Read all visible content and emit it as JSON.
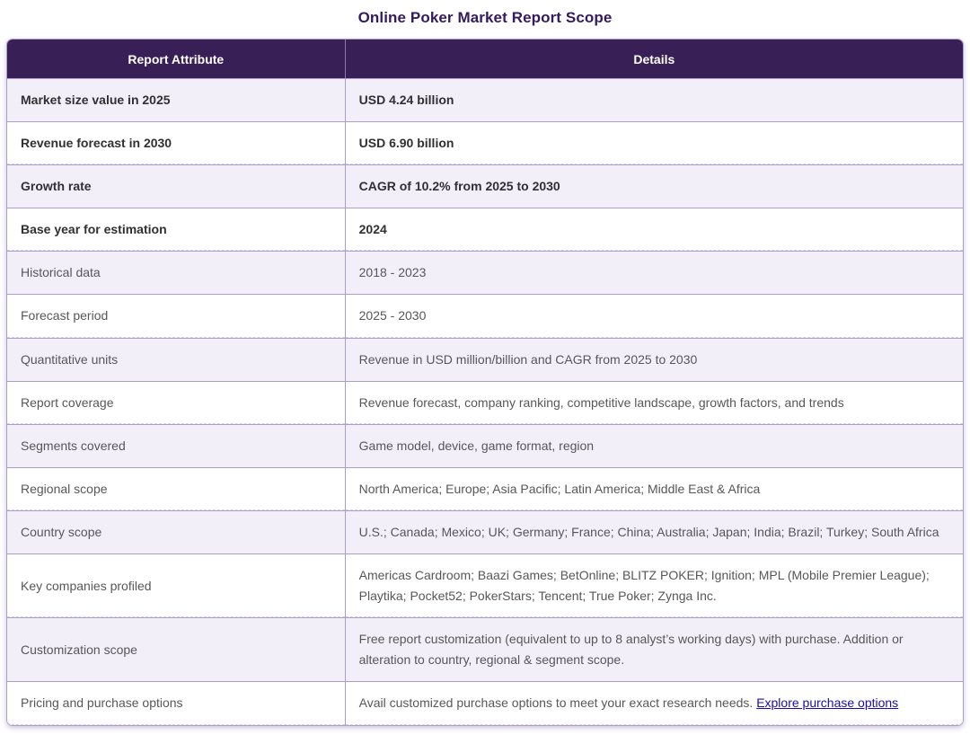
{
  "page": {
    "title": "Online Poker Market Report Scope"
  },
  "table": {
    "headers": {
      "attribute": "Report Attribute",
      "details": "Details"
    },
    "rows": [
      {
        "attribute": "Market size value in 2025",
        "details": "USD 4.24 billion"
      },
      {
        "attribute": "Revenue forecast in 2030",
        "details": "USD 6.90 billion"
      },
      {
        "attribute": "Growth rate",
        "details": "CAGR of 10.2% from 2025 to 2030"
      },
      {
        "attribute": "Base year for estimation",
        "details": "2024"
      },
      {
        "attribute": "Historical data",
        "details": "2018 - 2023"
      },
      {
        "attribute": "Forecast period",
        "details": "2025 - 2030"
      },
      {
        "attribute": "Quantitative units",
        "details": "Revenue in USD million/billion and CAGR from 2025 to 2030"
      },
      {
        "attribute": "Report coverage",
        "details": "Revenue forecast, company ranking, competitive landscape, growth factors, and trends"
      },
      {
        "attribute": "Segments covered",
        "details": "Game model, device, game format, region"
      },
      {
        "attribute": "Regional scope",
        "details": "North America; Europe; Asia Pacific; Latin America; Middle East & Africa"
      },
      {
        "attribute": "Country scope",
        "details": "U.S.; Canada; Mexico; UK; Germany; France; China; Australia; Japan; India; Brazil; Turkey; South Africa"
      },
      {
        "attribute": "Key companies profiled",
        "details": "Americas Cardroom; Baazi Games; BetOnline; BLITZ POKER; Ignition; MPL (Mobile Premier League); Playtika; Pocket52; PokerStars; Tencent; True Poker; Zynga Inc."
      },
      {
        "attribute": "Customization scope",
        "details": "Free report customization (equivalent to up to 8 analyst’s working days) with purchase. Addition or alteration to country, regional & segment scope."
      },
      {
        "attribute": "Pricing and purchase options",
        "details": "Avail customized purchase options to meet your exact research needs.",
        "link": {
          "label": "Explore purchase options"
        }
      }
    ]
  },
  "colors": {
    "header_bg": "#381f55",
    "title_text": "#321b5e",
    "row_alt_bg": "#f3eff8",
    "border": "#ab9dce",
    "link": "#1a0dab",
    "body_text": "#575757",
    "bold_text": "#303030"
  }
}
